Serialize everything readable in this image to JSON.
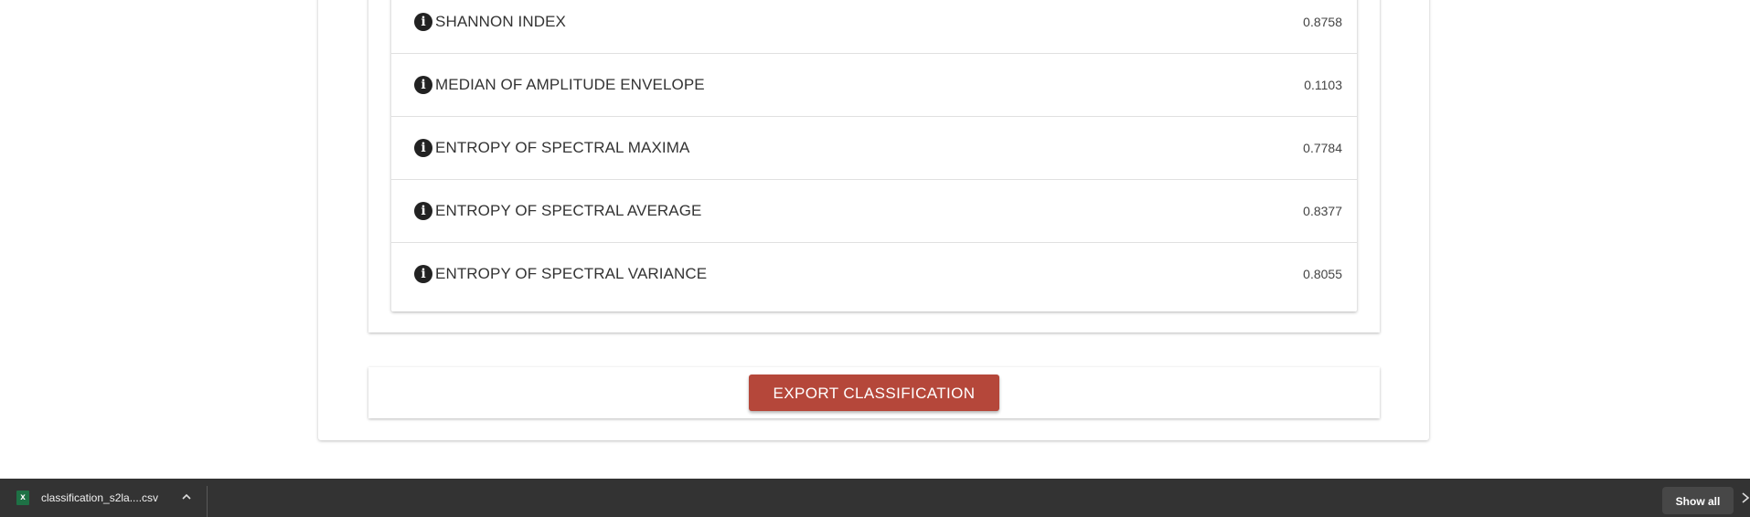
{
  "metrics": [
    {
      "label": "SHANNON INDEX",
      "value": "0.8758"
    },
    {
      "label": "MEDIAN OF AMPLITUDE ENVELOPE",
      "value": "0.1103"
    },
    {
      "label": "ENTROPY OF SPECTRAL MAXIMA",
      "value": "0.7784"
    },
    {
      "label": "ENTROPY OF SPECTRAL AVERAGE",
      "value": "0.8377"
    },
    {
      "label": "ENTROPY OF SPECTRAL VARIANCE",
      "value": "0.8055"
    }
  ],
  "info_icon_glyph": "i",
  "export": {
    "label": "EXPORT CLASSIFICATION",
    "color": "#b5473a"
  },
  "download_bar": {
    "file_name": "classification_s2la....csv",
    "file_icon": "excel-icon",
    "file_icon_glyph": "x",
    "show_all_label": "Show all"
  }
}
